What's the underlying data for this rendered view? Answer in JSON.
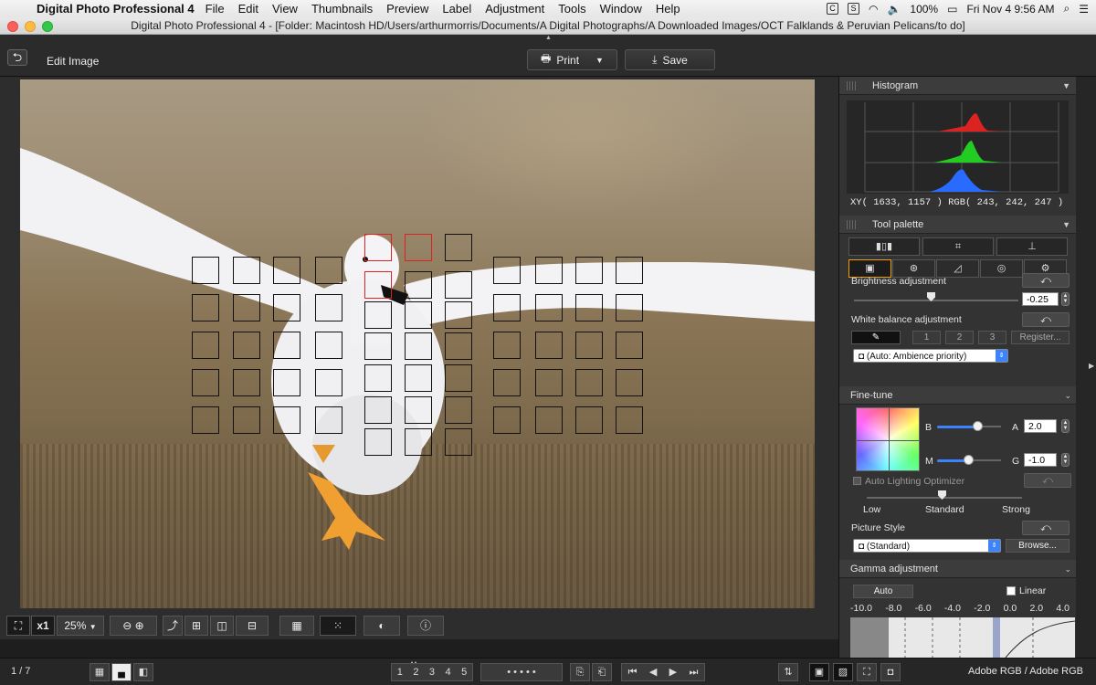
{
  "menubar": {
    "app_name": "Digital Photo Professional 4",
    "menus": [
      "File",
      "Edit",
      "View",
      "Thumbnails",
      "Preview",
      "Label",
      "Adjustment",
      "Tools",
      "Window",
      "Help"
    ],
    "battery": "100%",
    "clock": "Fri Nov 4  9:56 AM"
  },
  "window": {
    "title": "Digital Photo Professional 4 - [Folder: Macintosh HD/Users/arthurmorris/Documents/A Digital Photographs/A Downloaded Images/OCT Falklands & Peruvian Pelicans/to do]"
  },
  "toolbar": {
    "edit_title": "Edit Image",
    "print_label": "Print",
    "save_label": "Save"
  },
  "histogram": {
    "title": "Histogram",
    "xy_readout": "XY( 1633,  1157 ) RGB( 243, 242, 247 )"
  },
  "tool_palette": {
    "title": "Tool palette",
    "brightness": {
      "label": "Brightness adjustment",
      "value": "-0.25",
      "fraction": 0.47
    },
    "white_balance": {
      "label": "White balance adjustment",
      "btn1": "1",
      "btn2": "2",
      "btn3": "3",
      "register": "Register...",
      "mode": "(Auto: Ambience priority)"
    },
    "fine_tune": {
      "title": "Fine-tune",
      "b_label": "B",
      "a_label": "A",
      "a_value": "2.0",
      "m_label": "M",
      "g_label": "G",
      "g_value": "-1.0",
      "ba_fraction": 0.7,
      "mg_fraction": 0.55
    },
    "alo": {
      "label": "Auto Lighting Optimizer",
      "low": "Low",
      "standard": "Standard",
      "strong": "Strong"
    },
    "picture_style": {
      "label": "Picture Style",
      "value": "(Standard)",
      "browse": "Browse..."
    },
    "gamma": {
      "title": "Gamma adjustment",
      "auto": "Auto",
      "linear": "Linear",
      "ticks": [
        "-10.0",
        "-8.0",
        "-6.0",
        "-4.0",
        "-2.0",
        "0.0",
        "2.0",
        "4.0"
      ]
    }
  },
  "controls": {
    "zoom_x": "x1",
    "zoom_pct": "25%"
  },
  "status": {
    "page_count": "1 / 7",
    "colorspace": "Adobe RGB / Adobe RGB",
    "star_labels": [
      "1",
      "2",
      "3",
      "4",
      "5"
    ]
  },
  "colors": {
    "af_active": "#dd2222",
    "accent_orange": "#f2a200",
    "accent_blue": "#3b83ff"
  }
}
